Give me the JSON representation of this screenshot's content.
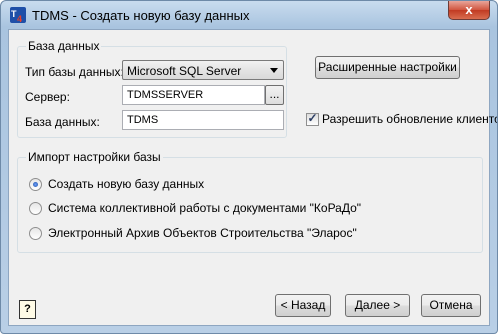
{
  "window": {
    "title": "TDMS - Создать новую базу данных",
    "close_label": "x"
  },
  "database_group": {
    "legend": "База данных",
    "type_label": "Тип базы данных:",
    "type_value": "Microsoft SQL Server",
    "server_label": "Сервер:",
    "server_value": "TDMSSERVER",
    "browse_label": "...",
    "db_label": "База данных:",
    "db_value": "TDMS"
  },
  "advanced_button_label": "Расширенные настройки",
  "allow_update": {
    "label": "Разрешить обновление клиенто",
    "checked": true,
    "check_mark": "✓"
  },
  "import_group": {
    "legend": "Импорт настройки базы",
    "options": [
      {
        "label": "Создать новую базу данных",
        "selected": true
      },
      {
        "label": "Система коллективной работы с документами \"КоРаДо\"",
        "selected": false
      },
      {
        "label": "Электронный Архив Объектов Строительства \"Эларос\"",
        "selected": false
      }
    ]
  },
  "footer": {
    "help_label": "?",
    "back_label": "< Назад",
    "next_label": "Далее >",
    "cancel_label": "Отмена"
  }
}
